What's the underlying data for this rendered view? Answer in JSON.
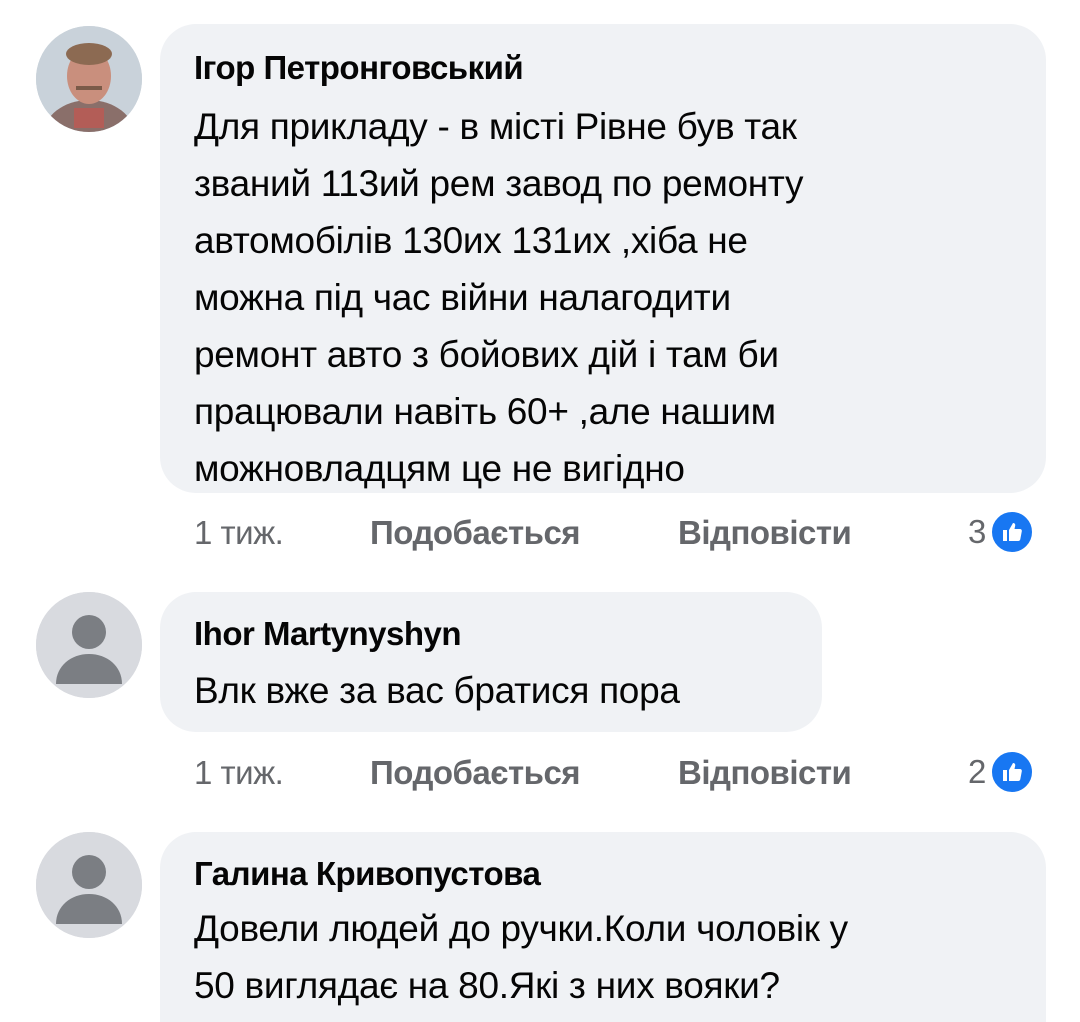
{
  "comments": [
    {
      "author": "Ігор Петронговський",
      "lines": [
        "Для прикладу - в місті Рівне був так",
        "званий 113ий рем завод по ремонту",
        "автомобілів 130их 131их ,хіба не",
        "можна під час війни налагодити",
        "ремонт авто з бойових дій і там би",
        "працювали навіть 60+ ,але нашим",
        "можновладцям це не вигідно"
      ],
      "time": "1 тиж.",
      "like_label": "Подобається",
      "reply_label": "Відповісти",
      "reaction_count": "3",
      "avatar_icon": "profile-photo"
    },
    {
      "author": "Ihor Martynyshyn",
      "lines": [
        "Влк вже за вас братися пора"
      ],
      "time": "1 тиж.",
      "like_label": "Подобається",
      "reply_label": "Відповісти",
      "reaction_count": "2",
      "avatar_icon": "default-avatar-icon"
    },
    {
      "author": "Галина Кривопустова",
      "lines": [
        "Довели людей до ручки.Коли чоловік у",
        "50 виглядає на 80.Які з них вояки?"
      ],
      "avatar_icon": "default-avatar-icon"
    }
  ],
  "colors": {
    "bubble": "#f0f2f5",
    "meta_text": "#65676b",
    "like_blue": "#1877f2"
  }
}
